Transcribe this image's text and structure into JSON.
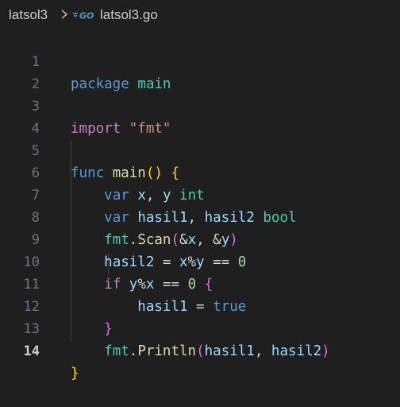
{
  "breadcrumb": {
    "folder": "latsol3",
    "file": "latsol3.go",
    "go_badge": "GO"
  },
  "lines": [
    {
      "num": "1"
    },
    {
      "num": "2"
    },
    {
      "num": "3"
    },
    {
      "num": "4"
    },
    {
      "num": "5"
    },
    {
      "num": "6"
    },
    {
      "num": "7"
    },
    {
      "num": "8"
    },
    {
      "num": "9"
    },
    {
      "num": "10"
    },
    {
      "num": "11"
    },
    {
      "num": "12"
    },
    {
      "num": "13"
    },
    {
      "num": "14"
    }
  ],
  "code": {
    "l1": [
      "package",
      "main"
    ],
    "l3": [
      "import",
      "\"fmt\""
    ],
    "l5": [
      "func",
      "main",
      "(",
      ")",
      "{"
    ],
    "l6": [
      "var",
      "x",
      ",",
      "y",
      "int"
    ],
    "l7": [
      "var",
      "hasil1",
      ",",
      "hasil2",
      "bool"
    ],
    "l8": [
      "fmt",
      ".",
      "Scan",
      "(",
      "&",
      "x",
      ", &",
      "y",
      ")"
    ],
    "l9": [
      "hasil2",
      " = ",
      "x",
      "%",
      "y",
      " == ",
      "0"
    ],
    "l10": [
      "if",
      "y",
      "%",
      "x",
      " == ",
      "0",
      "{"
    ],
    "l11": [
      "hasil1",
      " = ",
      "true"
    ],
    "l12": [
      "}"
    ],
    "l13": [
      "fmt",
      ".",
      "Println",
      "(",
      "hasil1",
      ", ",
      "hasil2",
      ")"
    ],
    "l14": [
      "}"
    ]
  },
  "colors": {
    "background": "#1f1f1f",
    "keyword": "#569cd6",
    "control": "#c586c0",
    "function": "#dcdcaa",
    "string": "#ce9178",
    "number": "#b5cea8",
    "variable": "#9cdcfe",
    "type": "#4ec9b0",
    "bracket_level1": "#ffd700",
    "bracket_level2": "#da70d6",
    "bracket_level3": "#179fff",
    "go_icon": "#519aba"
  },
  "active_line": "14"
}
